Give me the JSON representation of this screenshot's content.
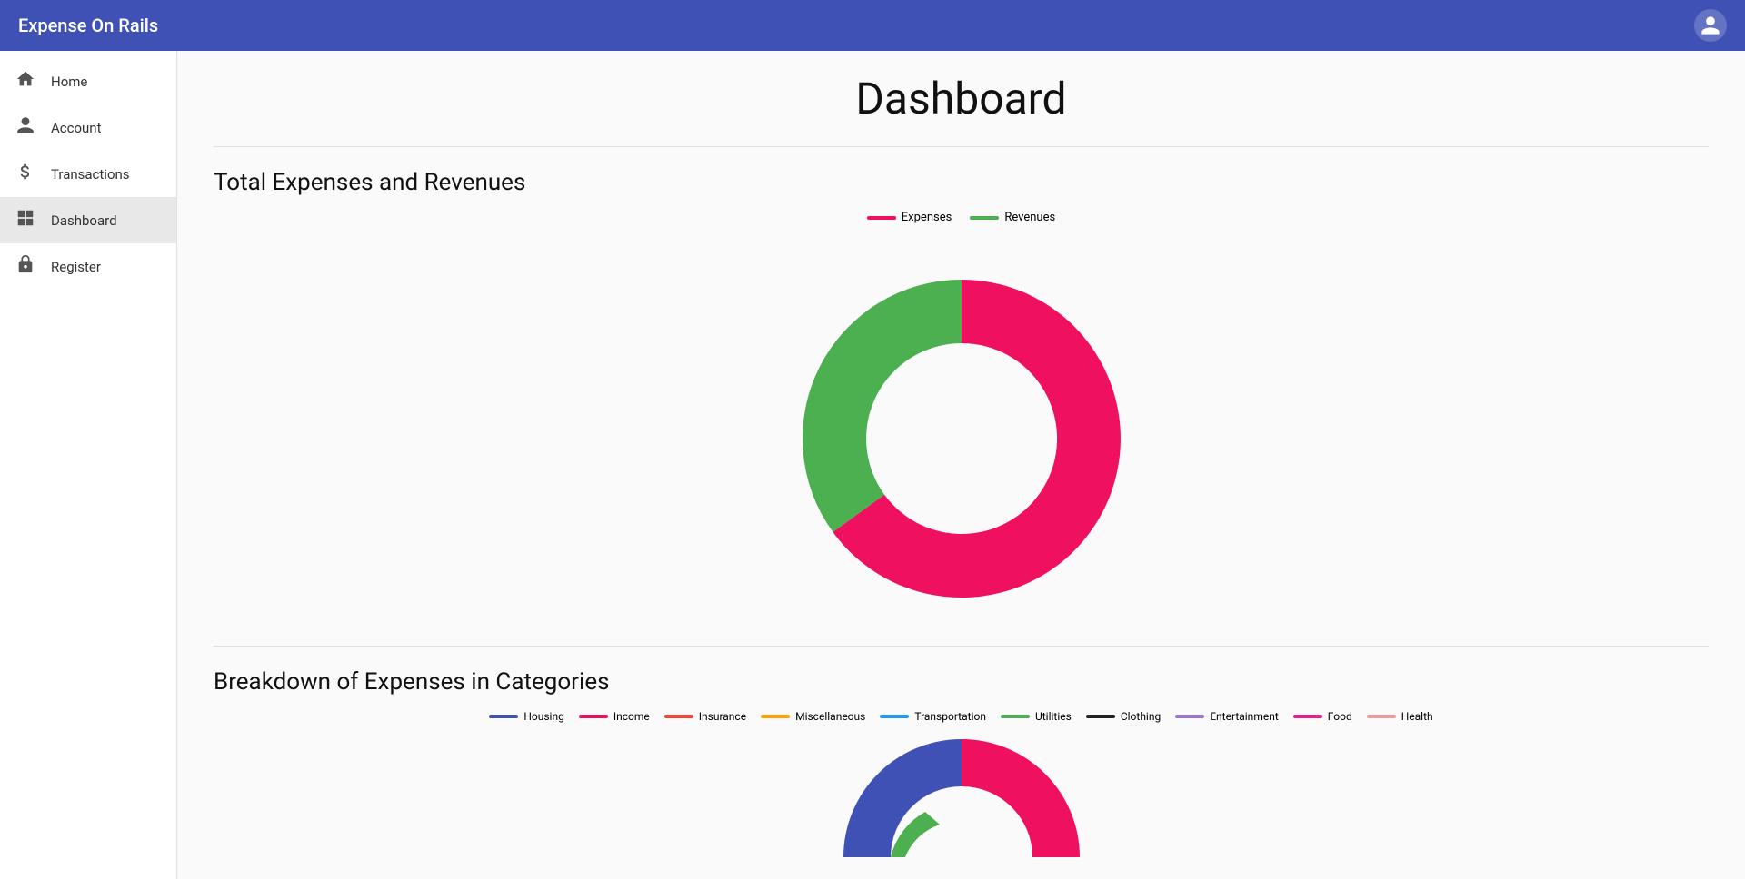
{
  "app": {
    "title": "Expense On Rails"
  },
  "sidebar": {
    "items": [
      {
        "id": "home",
        "label": "Home",
        "icon": "🏠",
        "active": false
      },
      {
        "id": "account",
        "label": "Account",
        "icon": "👤",
        "active": false
      },
      {
        "id": "transactions",
        "label": "Transactions",
        "icon": "💲",
        "active": false
      },
      {
        "id": "dashboard",
        "label": "Dashboard",
        "icon": "⊞",
        "active": true
      },
      {
        "id": "register",
        "label": "Register",
        "icon": "🔒",
        "active": false
      }
    ]
  },
  "main": {
    "page_title": "Dashboard",
    "donut_chart": {
      "title": "Total Expenses and Revenues",
      "expenses_pct": 65,
      "revenues_pct": 35,
      "expenses_color": "#f01060",
      "revenues_color": "#4caf50",
      "legend": [
        {
          "label": "Expenses",
          "color": "#f01060"
        },
        {
          "label": "Revenues",
          "color": "#4caf50"
        }
      ]
    },
    "categories_chart": {
      "title": "Breakdown of Expenses in Categories",
      "legend": [
        {
          "label": "Housing",
          "color": "#3f51b5"
        },
        {
          "label": "Income",
          "color": "#f01060"
        },
        {
          "label": "Insurance",
          "color": "#f44336"
        },
        {
          "label": "Miscellaneous",
          "color": "#ffa000"
        },
        {
          "label": "Transportation",
          "color": "#2196f3"
        },
        {
          "label": "Utilities",
          "color": "#4caf50"
        },
        {
          "label": "Clothing",
          "color": "#212121"
        },
        {
          "label": "Entertainment",
          "color": "#9575cd"
        },
        {
          "label": "Food",
          "color": "#e91e8c"
        },
        {
          "label": "Health",
          "color": "#ef9a9a"
        }
      ]
    }
  }
}
